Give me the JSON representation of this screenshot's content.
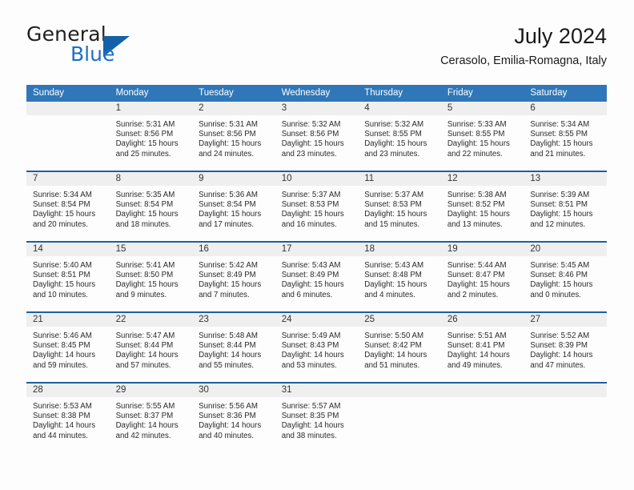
{
  "brand": {
    "name_part1": "General",
    "name_part2": "Blue",
    "accent_color": "#1461a8"
  },
  "header": {
    "month_title": "July 2024",
    "location": "Cerasolo, Emilia-Romagna, Italy"
  },
  "calendar": {
    "header_color": "#2f77b8",
    "weekday_headers": [
      "Sunday",
      "Monday",
      "Tuesday",
      "Wednesday",
      "Thursday",
      "Friday",
      "Saturday"
    ],
    "weeks": [
      [
        {
          "day": "",
          "sunrise": "",
          "sunset": "",
          "daylight_line1": "",
          "daylight_line2": ""
        },
        {
          "day": "1",
          "sunrise": "Sunrise: 5:31 AM",
          "sunset": "Sunset: 8:56 PM",
          "daylight_line1": "Daylight: 15 hours",
          "daylight_line2": "and 25 minutes."
        },
        {
          "day": "2",
          "sunrise": "Sunrise: 5:31 AM",
          "sunset": "Sunset: 8:56 PM",
          "daylight_line1": "Daylight: 15 hours",
          "daylight_line2": "and 24 minutes."
        },
        {
          "day": "3",
          "sunrise": "Sunrise: 5:32 AM",
          "sunset": "Sunset: 8:56 PM",
          "daylight_line1": "Daylight: 15 hours",
          "daylight_line2": "and 23 minutes."
        },
        {
          "day": "4",
          "sunrise": "Sunrise: 5:32 AM",
          "sunset": "Sunset: 8:55 PM",
          "daylight_line1": "Daylight: 15 hours",
          "daylight_line2": "and 23 minutes."
        },
        {
          "day": "5",
          "sunrise": "Sunrise: 5:33 AM",
          "sunset": "Sunset: 8:55 PM",
          "daylight_line1": "Daylight: 15 hours",
          "daylight_line2": "and 22 minutes."
        },
        {
          "day": "6",
          "sunrise": "Sunrise: 5:34 AM",
          "sunset": "Sunset: 8:55 PM",
          "daylight_line1": "Daylight: 15 hours",
          "daylight_line2": "and 21 minutes."
        }
      ],
      [
        {
          "day": "7",
          "sunrise": "Sunrise: 5:34 AM",
          "sunset": "Sunset: 8:54 PM",
          "daylight_line1": "Daylight: 15 hours",
          "daylight_line2": "and 20 minutes."
        },
        {
          "day": "8",
          "sunrise": "Sunrise: 5:35 AM",
          "sunset": "Sunset: 8:54 PM",
          "daylight_line1": "Daylight: 15 hours",
          "daylight_line2": "and 18 minutes."
        },
        {
          "day": "9",
          "sunrise": "Sunrise: 5:36 AM",
          "sunset": "Sunset: 8:54 PM",
          "daylight_line1": "Daylight: 15 hours",
          "daylight_line2": "and 17 minutes."
        },
        {
          "day": "10",
          "sunrise": "Sunrise: 5:37 AM",
          "sunset": "Sunset: 8:53 PM",
          "daylight_line1": "Daylight: 15 hours",
          "daylight_line2": "and 16 minutes."
        },
        {
          "day": "11",
          "sunrise": "Sunrise: 5:37 AM",
          "sunset": "Sunset: 8:53 PM",
          "daylight_line1": "Daylight: 15 hours",
          "daylight_line2": "and 15 minutes."
        },
        {
          "day": "12",
          "sunrise": "Sunrise: 5:38 AM",
          "sunset": "Sunset: 8:52 PM",
          "daylight_line1": "Daylight: 15 hours",
          "daylight_line2": "and 13 minutes."
        },
        {
          "day": "13",
          "sunrise": "Sunrise: 5:39 AM",
          "sunset": "Sunset: 8:51 PM",
          "daylight_line1": "Daylight: 15 hours",
          "daylight_line2": "and 12 minutes."
        }
      ],
      [
        {
          "day": "14",
          "sunrise": "Sunrise: 5:40 AM",
          "sunset": "Sunset: 8:51 PM",
          "daylight_line1": "Daylight: 15 hours",
          "daylight_line2": "and 10 minutes."
        },
        {
          "day": "15",
          "sunrise": "Sunrise: 5:41 AM",
          "sunset": "Sunset: 8:50 PM",
          "daylight_line1": "Daylight: 15 hours",
          "daylight_line2": "and 9 minutes."
        },
        {
          "day": "16",
          "sunrise": "Sunrise: 5:42 AM",
          "sunset": "Sunset: 8:49 PM",
          "daylight_line1": "Daylight: 15 hours",
          "daylight_line2": "and 7 minutes."
        },
        {
          "day": "17",
          "sunrise": "Sunrise: 5:43 AM",
          "sunset": "Sunset: 8:49 PM",
          "daylight_line1": "Daylight: 15 hours",
          "daylight_line2": "and 6 minutes."
        },
        {
          "day": "18",
          "sunrise": "Sunrise: 5:43 AM",
          "sunset": "Sunset: 8:48 PM",
          "daylight_line1": "Daylight: 15 hours",
          "daylight_line2": "and 4 minutes."
        },
        {
          "day": "19",
          "sunrise": "Sunrise: 5:44 AM",
          "sunset": "Sunset: 8:47 PM",
          "daylight_line1": "Daylight: 15 hours",
          "daylight_line2": "and 2 minutes."
        },
        {
          "day": "20",
          "sunrise": "Sunrise: 5:45 AM",
          "sunset": "Sunset: 8:46 PM",
          "daylight_line1": "Daylight: 15 hours",
          "daylight_line2": "and 0 minutes."
        }
      ],
      [
        {
          "day": "21",
          "sunrise": "Sunrise: 5:46 AM",
          "sunset": "Sunset: 8:45 PM",
          "daylight_line1": "Daylight: 14 hours",
          "daylight_line2": "and 59 minutes."
        },
        {
          "day": "22",
          "sunrise": "Sunrise: 5:47 AM",
          "sunset": "Sunset: 8:44 PM",
          "daylight_line1": "Daylight: 14 hours",
          "daylight_line2": "and 57 minutes."
        },
        {
          "day": "23",
          "sunrise": "Sunrise: 5:48 AM",
          "sunset": "Sunset: 8:44 PM",
          "daylight_line1": "Daylight: 14 hours",
          "daylight_line2": "and 55 minutes."
        },
        {
          "day": "24",
          "sunrise": "Sunrise: 5:49 AM",
          "sunset": "Sunset: 8:43 PM",
          "daylight_line1": "Daylight: 14 hours",
          "daylight_line2": "and 53 minutes."
        },
        {
          "day": "25",
          "sunrise": "Sunrise: 5:50 AM",
          "sunset": "Sunset: 8:42 PM",
          "daylight_line1": "Daylight: 14 hours",
          "daylight_line2": "and 51 minutes."
        },
        {
          "day": "26",
          "sunrise": "Sunrise: 5:51 AM",
          "sunset": "Sunset: 8:41 PM",
          "daylight_line1": "Daylight: 14 hours",
          "daylight_line2": "and 49 minutes."
        },
        {
          "day": "27",
          "sunrise": "Sunrise: 5:52 AM",
          "sunset": "Sunset: 8:39 PM",
          "daylight_line1": "Daylight: 14 hours",
          "daylight_line2": "and 47 minutes."
        }
      ],
      [
        {
          "day": "28",
          "sunrise": "Sunrise: 5:53 AM",
          "sunset": "Sunset: 8:38 PM",
          "daylight_line1": "Daylight: 14 hours",
          "daylight_line2": "and 44 minutes."
        },
        {
          "day": "29",
          "sunrise": "Sunrise: 5:55 AM",
          "sunset": "Sunset: 8:37 PM",
          "daylight_line1": "Daylight: 14 hours",
          "daylight_line2": "and 42 minutes."
        },
        {
          "day": "30",
          "sunrise": "Sunrise: 5:56 AM",
          "sunset": "Sunset: 8:36 PM",
          "daylight_line1": "Daylight: 14 hours",
          "daylight_line2": "and 40 minutes."
        },
        {
          "day": "31",
          "sunrise": "Sunrise: 5:57 AM",
          "sunset": "Sunset: 8:35 PM",
          "daylight_line1": "Daylight: 14 hours",
          "daylight_line2": "and 38 minutes."
        },
        {
          "day": "",
          "sunrise": "",
          "sunset": "",
          "daylight_line1": "",
          "daylight_line2": ""
        },
        {
          "day": "",
          "sunrise": "",
          "sunset": "",
          "daylight_line1": "",
          "daylight_line2": ""
        },
        {
          "day": "",
          "sunrise": "",
          "sunset": "",
          "daylight_line1": "",
          "daylight_line2": ""
        }
      ]
    ]
  }
}
